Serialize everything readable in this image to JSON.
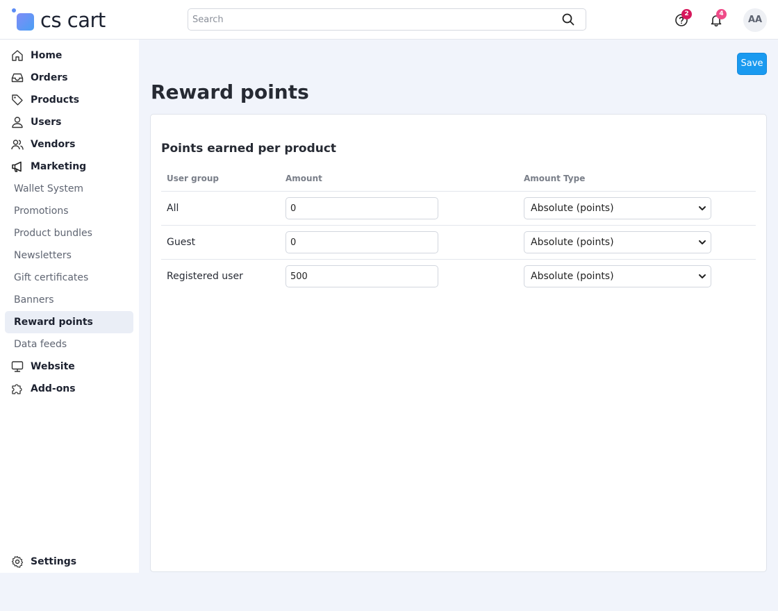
{
  "app": {
    "logo_text": "cs cart"
  },
  "search": {
    "placeholder": "Search"
  },
  "header": {
    "help_badge": "2",
    "notifications_badge": "4",
    "avatar_initials": "AA",
    "badge_colors": {
      "help": "#d6195c",
      "notifications": "#ef4b88"
    }
  },
  "sidebar": {
    "items": [
      {
        "label": "Home",
        "icon": "home-icon"
      },
      {
        "label": "Orders",
        "icon": "inbox-icon"
      },
      {
        "label": "Products",
        "icon": "tag-icon"
      },
      {
        "label": "Users",
        "icon": "user-icon"
      },
      {
        "label": "Vendors",
        "icon": "users-icon"
      },
      {
        "label": "Marketing",
        "icon": "megaphone-icon"
      },
      {
        "label": "Wallet System"
      },
      {
        "label": "Promotions"
      },
      {
        "label": "Product bundles"
      },
      {
        "label": "Newsletters"
      },
      {
        "label": "Gift certificates"
      },
      {
        "label": "Banners"
      },
      {
        "label": "Reward points",
        "active": true
      },
      {
        "label": "Data feeds"
      },
      {
        "label": "Website",
        "icon": "monitor-icon"
      },
      {
        "label": "Add-ons",
        "icon": "puzzle-icon"
      }
    ],
    "settings_label": "Settings"
  },
  "toolbar": {
    "save_label": "Save"
  },
  "page": {
    "title": "Reward points",
    "section_title": "Points earned per product",
    "table": {
      "headers": [
        "User group",
        "Amount",
        "Amount Type"
      ],
      "rows": [
        {
          "group": "All",
          "amount": "0",
          "type": "Absolute (points)"
        },
        {
          "group": "Guest",
          "amount": "0",
          "type": "Absolute (points)"
        },
        {
          "group": "Registered user",
          "amount": "500",
          "type": "Absolute (points)"
        }
      ]
    }
  },
  "colors": {
    "accent": "#1a9af0",
    "background": "#f1f4fb"
  }
}
